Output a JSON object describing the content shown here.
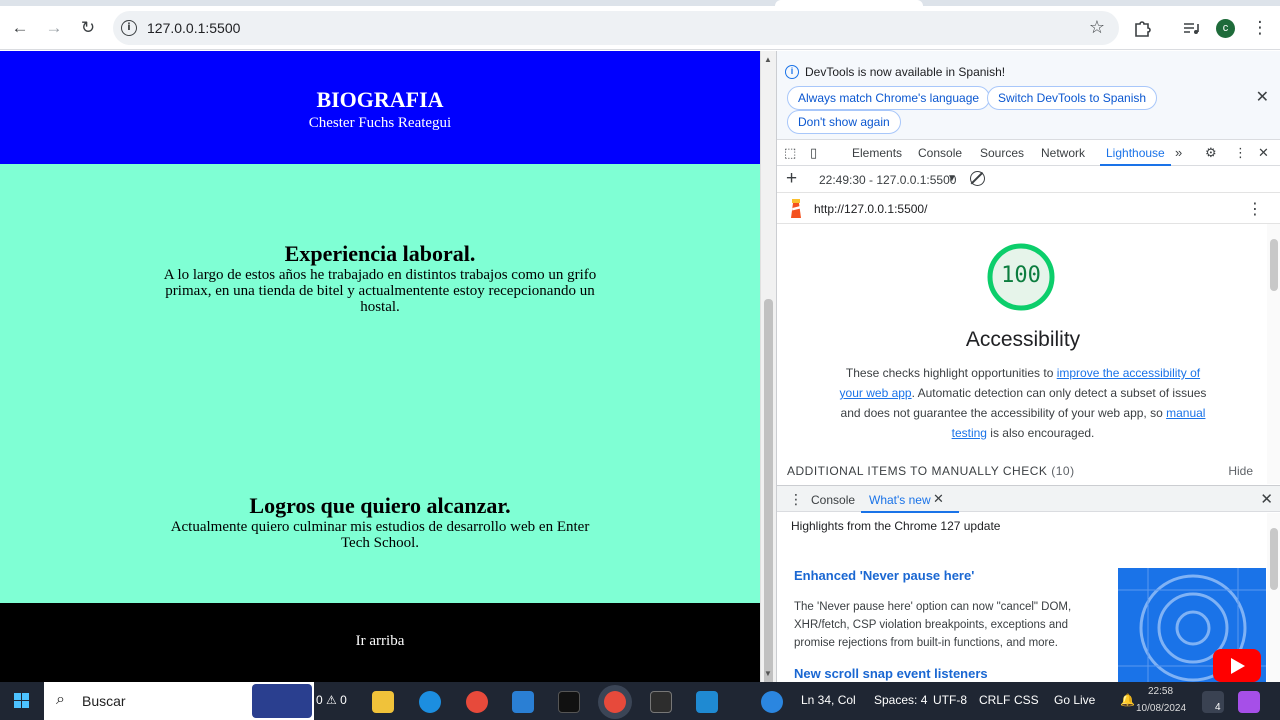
{
  "browser": {
    "url": "127.0.0.1:5500",
    "info_glyph": "i"
  },
  "page": {
    "header": {
      "title": "BIOGRAFIA",
      "subtitle": "Chester Fuchs Reategui"
    },
    "sections": [
      {
        "title": "Experiencia laboral.",
        "body": "A lo largo de estos años he trabajado en distintos trabajos como un grifo primax, en una tienda de bitel y actualmentente estoy recepcionando un hostal."
      },
      {
        "title": "Logros que quiero alcanzar.",
        "body": "Actualmente quiero culminar mis estudios de desarrollo web en Enter Tech School."
      }
    ],
    "footer_link": "Ir arriba",
    "colors": {
      "header_bg": "#0000ff",
      "main_bg": "#7fffd4",
      "footer_bg": "#000000"
    }
  },
  "devtools": {
    "infobar": {
      "message": "DevTools is now available in Spanish!",
      "btn_match": "Always match Chrome's language",
      "btn_switch": "Switch DevTools to Spanish",
      "btn_dont_show": "Don't show again"
    },
    "tabs": [
      "Elements",
      "Console",
      "Sources",
      "Network",
      "Lighthouse"
    ],
    "active_tab": "Lighthouse",
    "lighthouse": {
      "run_label": "22:49:30 - 127.0.0.1:5500",
      "report_url": "http://127.0.0.1:5500/",
      "score": "100",
      "category": "Accessibility",
      "desc_1": "These checks highlight opportunities to ",
      "link_1": "improve the accessibility of your web app",
      "desc_2": ". Automatic detection can only detect a subset of issues and does not guarantee the accessibility of your web app, so ",
      "link_2": "manual testing",
      "desc_3": " is also encouraged.",
      "manual_label": "ADDITIONAL ITEMS TO MANUALLY CHECK",
      "manual_count": "(10)",
      "hide_label": "Hide"
    },
    "drawer": {
      "tab_console": "Console",
      "tab_whats_new": "What's new",
      "subtitle": "Highlights from the Chrome 127 update",
      "item1_title": "Enhanced 'Never pause here'",
      "item1_body": "The 'Never pause here' option can now \"cancel\" DOM, XHR/fetch, CSP violation breakpoints, exceptions and promise rejections from built-in functions, and more.",
      "item2_title": "New scroll snap event listeners"
    }
  },
  "taskbar": {
    "search_label": "Buscar",
    "problems": "0 ⚠ 0",
    "cursor_pos": "Ln 34, Col",
    "spaces": "Spaces: 4",
    "encoding": "UTF-8",
    "eol": "CRLF",
    "lang": "CSS",
    "golive": "Go Live",
    "time": "22:58",
    "date": "10/08/2024",
    "badge": "4"
  }
}
